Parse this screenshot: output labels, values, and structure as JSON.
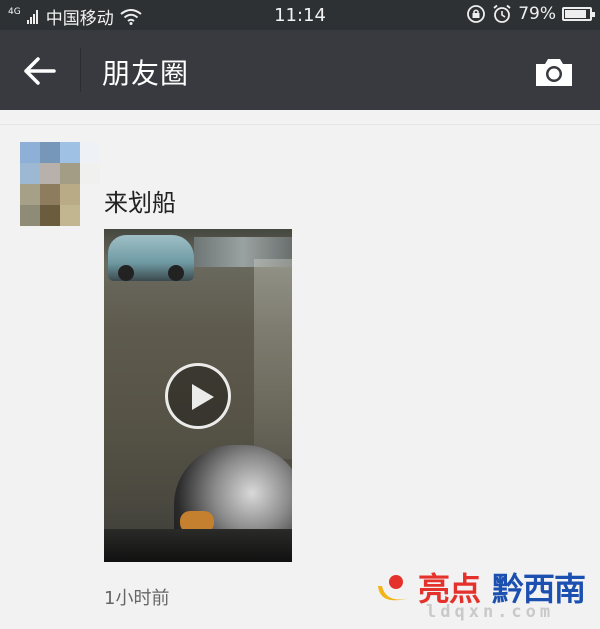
{
  "status_bar": {
    "network_type": "4G",
    "carrier": "中国移动",
    "time": "11:14",
    "battery_percent": "79%",
    "battery_level": 0.79,
    "icons": [
      "signal-icon",
      "wifi-icon",
      "rotation-lock-icon",
      "alarm-icon",
      "battery-icon"
    ]
  },
  "header": {
    "back_icon": "arrow-left-icon",
    "title": "朋友圈",
    "camera_icon": "camera-icon"
  },
  "post": {
    "text": "来划船",
    "media": "video",
    "play_icon": "play-icon",
    "time_ago": "1小时前"
  },
  "watermark": {
    "brand_red": "亮点",
    "brand_blue": "黔西南",
    "url": "ldqxn.com",
    "colors": {
      "red": "#e5312b",
      "blue": "#1b4fb0"
    }
  },
  "colors": {
    "status_bar_bg": "#2e3134",
    "title_bar_bg": "#393a3f",
    "page_bg": "#f2f2f2"
  }
}
